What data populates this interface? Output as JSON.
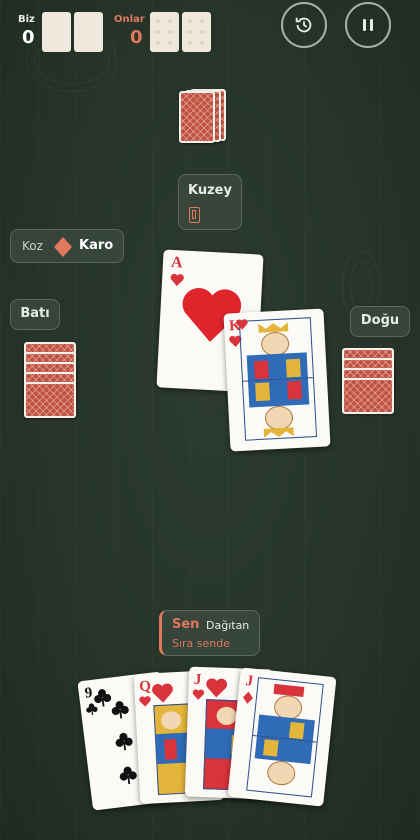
{
  "score": {
    "team_us": {
      "label": "Biz",
      "value": "0"
    },
    "team_them": {
      "label": "Onlar",
      "value": "0"
    }
  },
  "players": {
    "north": {
      "name": "Kuzey"
    },
    "west": {
      "name": "Batı"
    },
    "east": {
      "name": "Doğu"
    }
  },
  "trump": {
    "label": "Koz",
    "suit": "Karo"
  },
  "status": {
    "player": "Sen",
    "role": "Dağıtan",
    "message": "Sıra sende"
  },
  "played_cards": [
    {
      "rank": "A",
      "suit": "hearts"
    },
    {
      "rank": "K",
      "suit": "hearts"
    }
  ],
  "hand": [
    {
      "rank": "9",
      "suit": "clubs"
    },
    {
      "rank": "Q",
      "suit": "hearts"
    },
    {
      "rank": "J",
      "suit": "hearts"
    },
    {
      "rank": "J",
      "suit": "diamonds"
    }
  ],
  "colors": {
    "accent": "#e0785d",
    "red_suit": "#d9333b",
    "felt": "#26342a",
    "card_back": "#c0523f"
  },
  "icons": {
    "history": "history-icon",
    "pause": "pause-icon"
  }
}
